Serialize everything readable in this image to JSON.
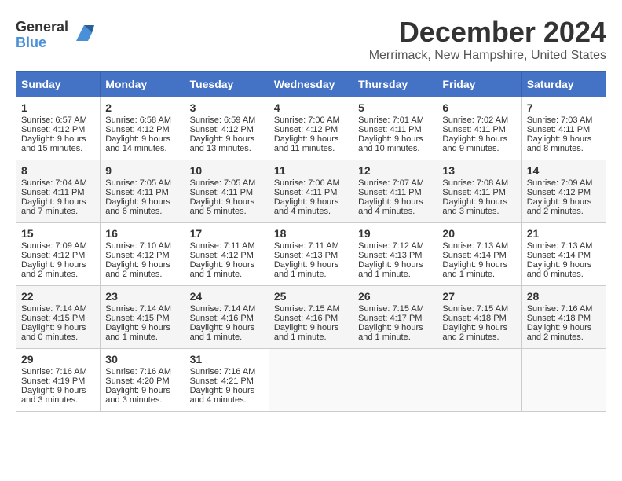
{
  "header": {
    "logo_general": "General",
    "logo_blue": "Blue",
    "title": "December 2024",
    "location": "Merrimack, New Hampshire, United States"
  },
  "days_of_week": [
    "Sunday",
    "Monday",
    "Tuesday",
    "Wednesday",
    "Thursday",
    "Friday",
    "Saturday"
  ],
  "weeks": [
    [
      {
        "day": "1",
        "sunrise": "Sunrise: 6:57 AM",
        "sunset": "Sunset: 4:12 PM",
        "daylight": "Daylight: 9 hours and 15 minutes."
      },
      {
        "day": "2",
        "sunrise": "Sunrise: 6:58 AM",
        "sunset": "Sunset: 4:12 PM",
        "daylight": "Daylight: 9 hours and 14 minutes."
      },
      {
        "day": "3",
        "sunrise": "Sunrise: 6:59 AM",
        "sunset": "Sunset: 4:12 PM",
        "daylight": "Daylight: 9 hours and 13 minutes."
      },
      {
        "day": "4",
        "sunrise": "Sunrise: 7:00 AM",
        "sunset": "Sunset: 4:12 PM",
        "daylight": "Daylight: 9 hours and 11 minutes."
      },
      {
        "day": "5",
        "sunrise": "Sunrise: 7:01 AM",
        "sunset": "Sunset: 4:11 PM",
        "daylight": "Daylight: 9 hours and 10 minutes."
      },
      {
        "day": "6",
        "sunrise": "Sunrise: 7:02 AM",
        "sunset": "Sunset: 4:11 PM",
        "daylight": "Daylight: 9 hours and 9 minutes."
      },
      {
        "day": "7",
        "sunrise": "Sunrise: 7:03 AM",
        "sunset": "Sunset: 4:11 PM",
        "daylight": "Daylight: 9 hours and 8 minutes."
      }
    ],
    [
      {
        "day": "8",
        "sunrise": "Sunrise: 7:04 AM",
        "sunset": "Sunset: 4:11 PM",
        "daylight": "Daylight: 9 hours and 7 minutes."
      },
      {
        "day": "9",
        "sunrise": "Sunrise: 7:05 AM",
        "sunset": "Sunset: 4:11 PM",
        "daylight": "Daylight: 9 hours and 6 minutes."
      },
      {
        "day": "10",
        "sunrise": "Sunrise: 7:05 AM",
        "sunset": "Sunset: 4:11 PM",
        "daylight": "Daylight: 9 hours and 5 minutes."
      },
      {
        "day": "11",
        "sunrise": "Sunrise: 7:06 AM",
        "sunset": "Sunset: 4:11 PM",
        "daylight": "Daylight: 9 hours and 4 minutes."
      },
      {
        "day": "12",
        "sunrise": "Sunrise: 7:07 AM",
        "sunset": "Sunset: 4:11 PM",
        "daylight": "Daylight: 9 hours and 4 minutes."
      },
      {
        "day": "13",
        "sunrise": "Sunrise: 7:08 AM",
        "sunset": "Sunset: 4:11 PM",
        "daylight": "Daylight: 9 hours and 3 minutes."
      },
      {
        "day": "14",
        "sunrise": "Sunrise: 7:09 AM",
        "sunset": "Sunset: 4:12 PM",
        "daylight": "Daylight: 9 hours and 2 minutes."
      }
    ],
    [
      {
        "day": "15",
        "sunrise": "Sunrise: 7:09 AM",
        "sunset": "Sunset: 4:12 PM",
        "daylight": "Daylight: 9 hours and 2 minutes."
      },
      {
        "day": "16",
        "sunrise": "Sunrise: 7:10 AM",
        "sunset": "Sunset: 4:12 PM",
        "daylight": "Daylight: 9 hours and 2 minutes."
      },
      {
        "day": "17",
        "sunrise": "Sunrise: 7:11 AM",
        "sunset": "Sunset: 4:12 PM",
        "daylight": "Daylight: 9 hours and 1 minute."
      },
      {
        "day": "18",
        "sunrise": "Sunrise: 7:11 AM",
        "sunset": "Sunset: 4:13 PM",
        "daylight": "Daylight: 9 hours and 1 minute."
      },
      {
        "day": "19",
        "sunrise": "Sunrise: 7:12 AM",
        "sunset": "Sunset: 4:13 PM",
        "daylight": "Daylight: 9 hours and 1 minute."
      },
      {
        "day": "20",
        "sunrise": "Sunrise: 7:13 AM",
        "sunset": "Sunset: 4:14 PM",
        "daylight": "Daylight: 9 hours and 1 minute."
      },
      {
        "day": "21",
        "sunrise": "Sunrise: 7:13 AM",
        "sunset": "Sunset: 4:14 PM",
        "daylight": "Daylight: 9 hours and 0 minutes."
      }
    ],
    [
      {
        "day": "22",
        "sunrise": "Sunrise: 7:14 AM",
        "sunset": "Sunset: 4:15 PM",
        "daylight": "Daylight: 9 hours and 0 minutes."
      },
      {
        "day": "23",
        "sunrise": "Sunrise: 7:14 AM",
        "sunset": "Sunset: 4:15 PM",
        "daylight": "Daylight: 9 hours and 1 minute."
      },
      {
        "day": "24",
        "sunrise": "Sunrise: 7:14 AM",
        "sunset": "Sunset: 4:16 PM",
        "daylight": "Daylight: 9 hours and 1 minute."
      },
      {
        "day": "25",
        "sunrise": "Sunrise: 7:15 AM",
        "sunset": "Sunset: 4:16 PM",
        "daylight": "Daylight: 9 hours and 1 minute."
      },
      {
        "day": "26",
        "sunrise": "Sunrise: 7:15 AM",
        "sunset": "Sunset: 4:17 PM",
        "daylight": "Daylight: 9 hours and 1 minute."
      },
      {
        "day": "27",
        "sunrise": "Sunrise: 7:15 AM",
        "sunset": "Sunset: 4:18 PM",
        "daylight": "Daylight: 9 hours and 2 minutes."
      },
      {
        "day": "28",
        "sunrise": "Sunrise: 7:16 AM",
        "sunset": "Sunset: 4:18 PM",
        "daylight": "Daylight: 9 hours and 2 minutes."
      }
    ],
    [
      {
        "day": "29",
        "sunrise": "Sunrise: 7:16 AM",
        "sunset": "Sunset: 4:19 PM",
        "daylight": "Daylight: 9 hours and 3 minutes."
      },
      {
        "day": "30",
        "sunrise": "Sunrise: 7:16 AM",
        "sunset": "Sunset: 4:20 PM",
        "daylight": "Daylight: 9 hours and 3 minutes."
      },
      {
        "day": "31",
        "sunrise": "Sunrise: 7:16 AM",
        "sunset": "Sunset: 4:21 PM",
        "daylight": "Daylight: 9 hours and 4 minutes."
      },
      null,
      null,
      null,
      null
    ]
  ]
}
